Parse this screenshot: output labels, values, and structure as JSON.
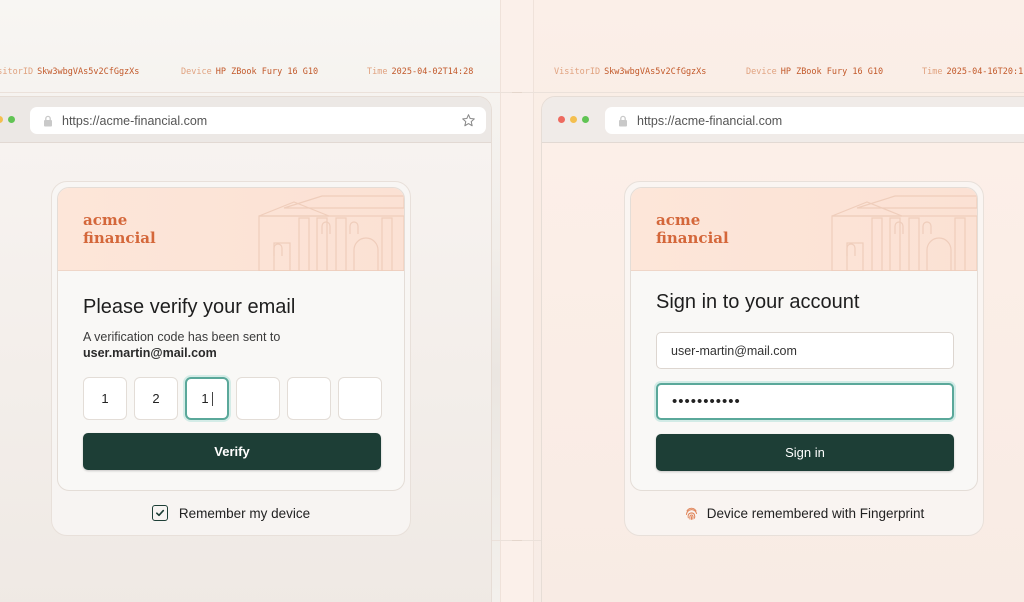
{
  "left": {
    "meta": {
      "visitor_label": "VisitorID",
      "visitor_value": "Skw3wbgVAs5v2CfGgzXs",
      "device_label": "Device",
      "device_value": "HP ZBook Fury 16 G10",
      "time_label": "Time",
      "time_value": "2025-04-02T14:28"
    },
    "browser": {
      "url": "https://acme-financial.com"
    },
    "card": {
      "brand_line1": "acme",
      "brand_line2": "financial",
      "title": "Please verify your email",
      "subtitle": "A verification code has been sent to",
      "email": "user.martin@mail.com",
      "otp": [
        "1",
        "2",
        "1",
        "",
        "",
        ""
      ],
      "button_label": "Verify"
    },
    "footer": {
      "label": "Remember my device",
      "checked": true
    }
  },
  "right": {
    "meta": {
      "visitor_label": "VisitorID",
      "visitor_value": "Skw3wbgVAs5v2CfGgzXs",
      "device_label": "Device",
      "device_value": "HP ZBook Fury 16 G10",
      "time_label": "Time",
      "time_value": "2025-04-16T20:1"
    },
    "browser": {
      "url": "https://acme-financial.com"
    },
    "card": {
      "brand_line1": "acme",
      "brand_line2": "financial",
      "title": "Sign in to your account",
      "email_value": "user-martin@mail.com",
      "password_value": "•••••••••••",
      "button_label": "Sign in"
    },
    "footer": {
      "label": "Device remembered with Fingerprint"
    }
  },
  "colors": {
    "accent": "#d4673a",
    "primary_button": "#1d3e36",
    "focus_ring": "#5aa89a"
  },
  "icons": [
    "lock-icon",
    "star-icon",
    "checkbox-icon",
    "fingerprint-icon"
  ]
}
